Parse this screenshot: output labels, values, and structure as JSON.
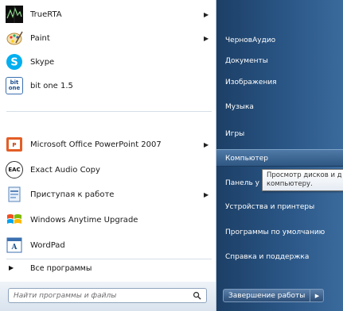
{
  "pinned": [
    {
      "label": "TrueRTA",
      "icon": "truerta-icon",
      "has_arrow": true
    },
    {
      "label": "Paint",
      "icon": "paint-icon",
      "has_arrow": true
    },
    {
      "label": "Skype",
      "icon": "skype-icon",
      "has_arrow": false
    },
    {
      "label": "bit one 1.5",
      "icon": "bitone-icon",
      "icon_text": "bit one",
      "has_arrow": false
    }
  ],
  "recent": [
    {
      "label": "Microsoft Office PowerPoint 2007",
      "icon": "powerpoint-icon",
      "has_arrow": true
    },
    {
      "label": "Exact Audio Copy",
      "icon": "eac-icon",
      "icon_text": "EAC",
      "has_arrow": false
    },
    {
      "label": "Приступая к работе",
      "icon": "getting-started-icon",
      "has_arrow": true
    },
    {
      "label": "Windows Anytime Upgrade",
      "icon": "windows-flag-icon",
      "has_arrow": false
    },
    {
      "label": "WordPad",
      "icon": "wordpad-icon",
      "has_arrow": false
    }
  ],
  "all_programs": "Все программы",
  "search_placeholder": "Найти программы и файлы",
  "right_links": [
    {
      "label": "ЧерновАудио"
    },
    {
      "label": "Документы"
    },
    {
      "label": "Изображения"
    },
    {
      "label": "Музыка"
    },
    {
      "label": "Игры"
    },
    {
      "label": "Компьютер",
      "highlighted": true
    },
    {
      "label": "Панель у"
    },
    {
      "label": "Устройства и принтеры"
    },
    {
      "label": "Программы по умолчанию"
    },
    {
      "label": "Справка и поддержка"
    }
  ],
  "shutdown_label": "Завершение работы",
  "tooltip": {
    "line1": "Просмотр дисков и д",
    "line2": "компьютеру."
  },
  "colors": {
    "right_panel": "#2a5686",
    "highlight": "#4f79a6",
    "tooltip_border": "#767676"
  }
}
